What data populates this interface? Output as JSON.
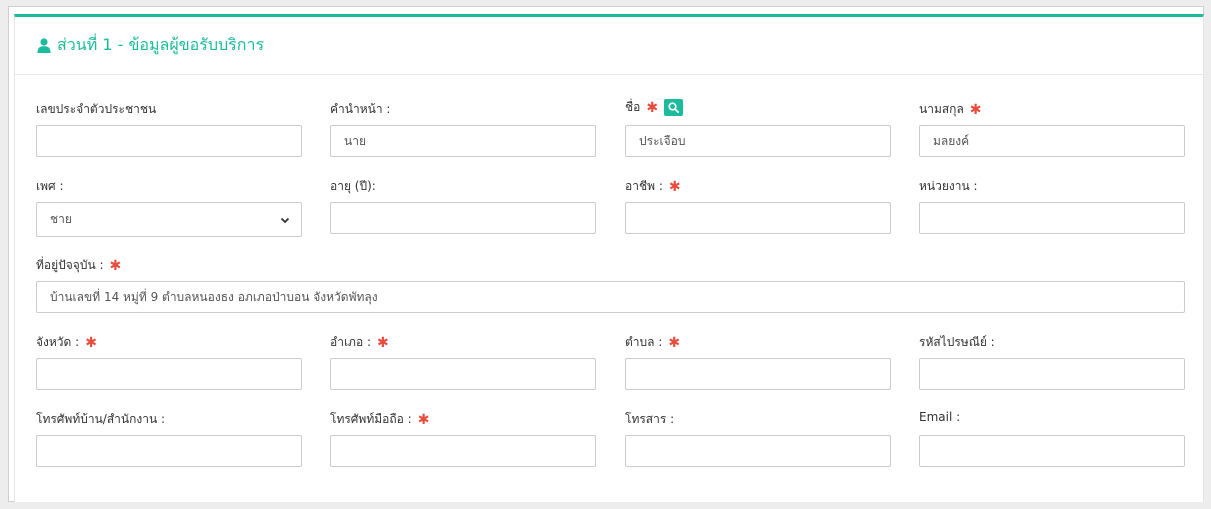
{
  "section": {
    "title": "ส่วนที่ 1 - ข้อมูลผู้ขอรับบริการ"
  },
  "accent_color": "#1bbc9b",
  "required_color": "#e74c3c",
  "required_mark": "✱",
  "fields": {
    "citizen_id": {
      "label": "เลขประจำตัวประชาชน",
      "value": ""
    },
    "prefix": {
      "label": "คำนำหน้า :",
      "value": "นาย"
    },
    "first_name": {
      "label": "ชื่อ",
      "value": "ประเจือบ",
      "required": true
    },
    "last_name": {
      "label": "นามสกุล",
      "value": "มลยงค์",
      "required": true
    },
    "gender": {
      "label": "เพศ :",
      "value": "ชาย"
    },
    "age": {
      "label": "อายุ (ปี):",
      "value": ""
    },
    "occupation": {
      "label": "อาชีพ :",
      "value": "",
      "required": true
    },
    "agency": {
      "label": "หน่วยงาน :",
      "value": ""
    },
    "address": {
      "label": "ที่อยู่ปัจจุบัน :",
      "value": "บ้านเลขที่ 14 หมู่ที่ 9 ตำบลหนองธง อภเภอป่าบอน จังหวัดพัทลุง",
      "required": true
    },
    "province": {
      "label": "จังหวัด :",
      "value": "",
      "required": true
    },
    "district": {
      "label": "อำเภอ :",
      "value": "",
      "required": true
    },
    "subdistrict": {
      "label": "ตำบล :",
      "value": "",
      "required": true
    },
    "postal_code": {
      "label": "รหัสไปรษณีย์ :",
      "value": ""
    },
    "home_phone": {
      "label": "โทรศัพท์บ้าน/สำนักงาน :",
      "value": ""
    },
    "mobile_phone": {
      "label": "โทรศัพท์มือถือ :",
      "value": "",
      "required": true
    },
    "fax": {
      "label": "โทรสาร :",
      "value": ""
    },
    "email": {
      "label": "Email :",
      "value": ""
    }
  }
}
